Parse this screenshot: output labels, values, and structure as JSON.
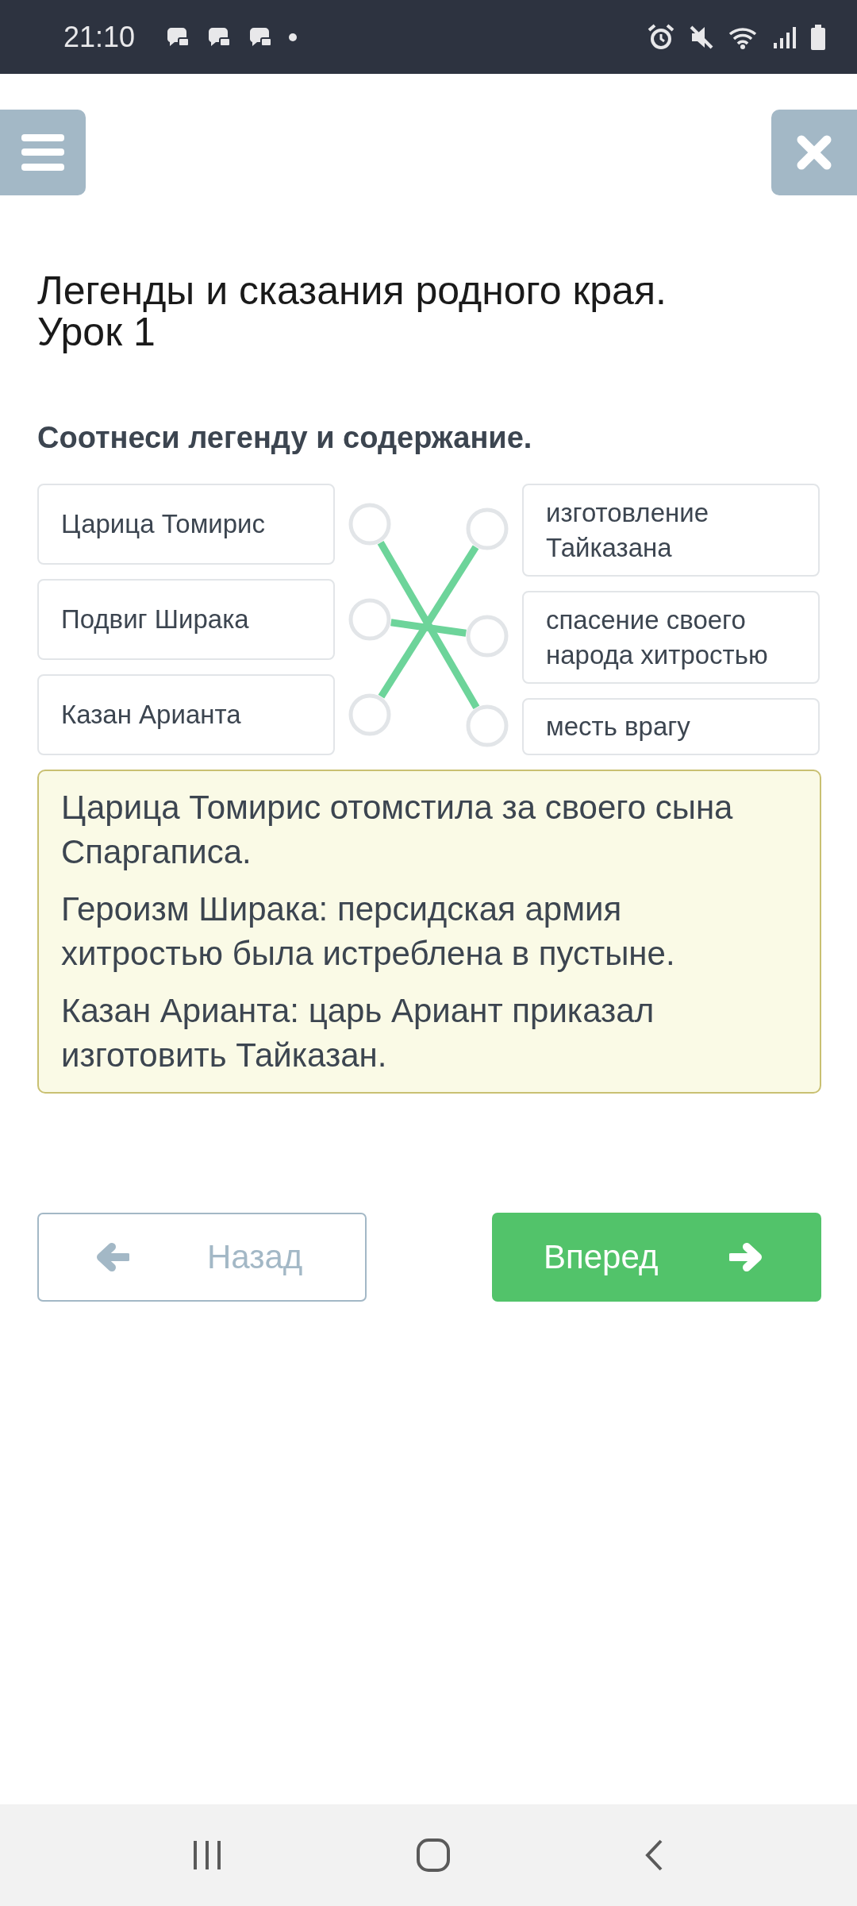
{
  "status_bar": {
    "time": "21:10"
  },
  "header": {
    "title": "Легенды и сказания родного края. Урок 1"
  },
  "question": "Соотнеси легенду и содержание.",
  "left_items": [
    {
      "text": "Царица Томирис",
      "linked_right": [
        false,
        false,
        true
      ]
    },
    {
      "text": "Подвиг Ширака",
      "linked_right": [
        false,
        true,
        false
      ]
    },
    {
      "text": "Казан Арианта",
      "linked_right": [
        true,
        false,
        false
      ]
    }
  ],
  "right_items": [
    {
      "text": "изготовление Тайказана"
    },
    {
      "text": "спасение своего народа хитростью"
    },
    {
      "text": "месть врагу"
    }
  ],
  "feedback": [
    "Царица Томирис отомстила за своего сына Спаргаписа.",
    "Героизм Ширака: персидская армия хитростью была истреблена в пустыне.",
    "Казан Арианта: царь Ариант приказал изготовить Тайказан."
  ],
  "buttons": [
    {
      "kind": "back",
      "label": "Назад"
    },
    {
      "kind": "next",
      "label": "Вперед"
    }
  ]
}
